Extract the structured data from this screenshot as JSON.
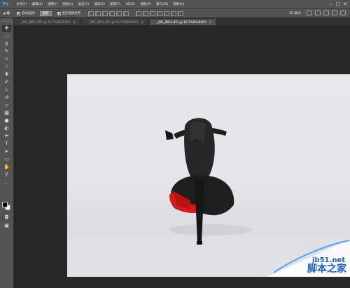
{
  "app": {
    "logo": "Ps"
  },
  "menu": {
    "items": [
      "文件(F)",
      "编辑(E)",
      "图像(I)",
      "图层(L)",
      "类型(Y)",
      "选择(S)",
      "滤镜(T)",
      "3D(D)",
      "视图(V)",
      "窗口(W)",
      "帮助(H)"
    ]
  },
  "window_controls": {
    "minimize": "–",
    "maximize": "□",
    "close": "✕"
  },
  "options_bar": {
    "auto_select_label": "自动选择：",
    "auto_select_value": "图层",
    "transform_label": "显示变换控件",
    "mode_label": "3D 模式："
  },
  "tabs": [
    {
      "label": "_MG_8857.JPG @ 16.7%(RGB/8*)",
      "active": false
    },
    {
      "label": "_MG_8851.JPG @ 16.7%(RGB/8*)",
      "active": false
    },
    {
      "label": "_MG_8831.JPG @ 16.7%(RGB/8*)",
      "active": true
    }
  ],
  "tab_close_glyph": "×",
  "watermark": {
    "text": "jb51.net",
    "text_cn": "脚本之家"
  },
  "colors": {
    "panel": "#535353",
    "workspace": "#282828",
    "sole": "#d41a1a",
    "shoe": "#1c1c1c",
    "watermark": "#1d5fbf"
  }
}
